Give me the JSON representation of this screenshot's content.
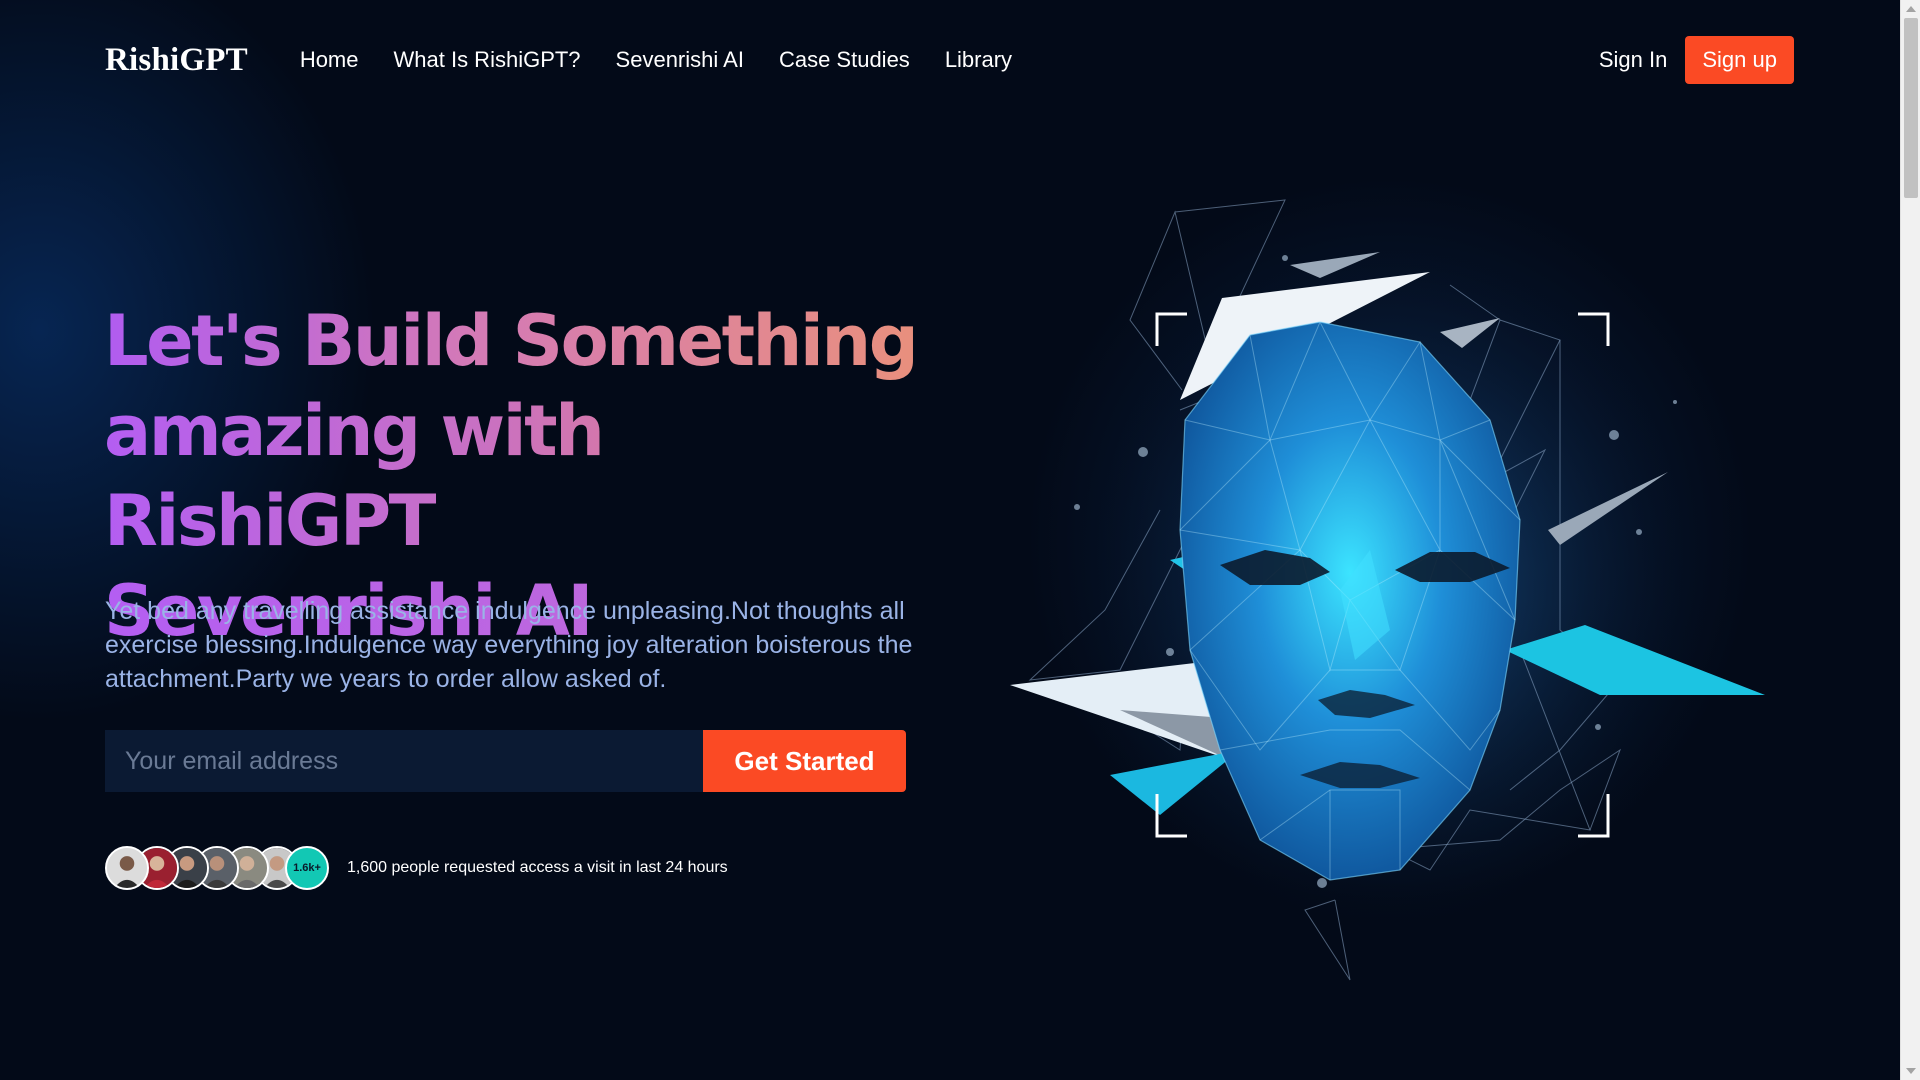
{
  "nav": {
    "logo": "RishiGPT",
    "links": [
      "Home",
      "What Is RishiGPT?",
      "Sevenrishi AI",
      "Case Studies",
      "Library"
    ],
    "signin": "Sign In",
    "signup": "Sign up"
  },
  "hero": {
    "headline_line1": "Let's Build Something",
    "headline_line2": "amazing with RishiGPT",
    "headline_line3": "Sevenrishi AI",
    "subtext": "Yet bed any travelling assistance indulgence unpleasing.Not thoughts all exercise blessing.Indulgence way everything joy alteration boisterous the attachment.Party we years to order allow asked of.",
    "email_placeholder": "Your email address",
    "cta": "Get Started",
    "avatar_count_badge": "1.6k+",
    "social_proof": "1,600 people requested access a visit in last 24 hours"
  },
  "illustration": {
    "icon": "polygonal-face-illustration"
  },
  "colors": {
    "accent": "#fb4a24",
    "background": "#030a18",
    "badge": "#12c8b4",
    "subtext": "#9ab3e6"
  }
}
